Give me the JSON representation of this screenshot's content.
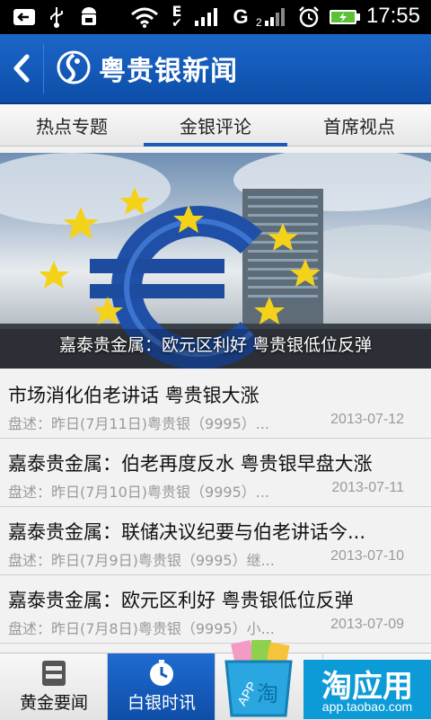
{
  "status_bar": {
    "time": "17:55",
    "icons": [
      "back-arrow-icon",
      "usb-icon",
      "android-icon",
      "wifi-icon",
      "edge-signal-icon",
      "signal-bars-icon",
      "g-network-icon",
      "signal-bars-2-icon",
      "alarm-icon",
      "battery-charging-icon"
    ],
    "signal_label_e": "E",
    "signal_label_g": "G"
  },
  "app_bar": {
    "title": "粤贵银新闻",
    "back_icon": "chevron-left-icon",
    "logo_icon": "swirl-logo-icon",
    "color": "#0d4ea8"
  },
  "tabs": [
    {
      "label": "热点专题",
      "active": false
    },
    {
      "label": "金银评论",
      "active": true
    },
    {
      "label": "首席视点",
      "active": false
    }
  ],
  "banner": {
    "caption": "嘉泰贵金属：欧元区利好 粤贵银低位反弹",
    "image_icon": "euro-sculpture-image"
  },
  "news": [
    {
      "title": "市场消化伯老讲话 粤贵银大涨",
      "summary": "盘述：昨日(7月11日)粤贵银（9995）...",
      "date": "2013-07-12"
    },
    {
      "title": "嘉泰贵金属：伯老再度反水 粤贵银早盘大涨",
      "summary": "盘述：昨日(7月10日)粤贵银（9995）...",
      "date": "2013-07-11"
    },
    {
      "title": "嘉泰贵金属：联储决议纪要与伯老讲话今...",
      "summary": "盘述：昨日(7月9日)粤贵银（9995）继...",
      "date": "2013-07-10"
    },
    {
      "title": "嘉泰贵金属：欧元区利好 粤贵银低位反弹",
      "summary": "盘述：昨日(7月8日)粤贵银（9995）小...",
      "date": "2013-07-09"
    }
  ],
  "bottom_nav": [
    {
      "label": "黄金要闻",
      "icon": "document-icon",
      "active": false
    },
    {
      "label": "白银时讯",
      "icon": "clock-icon",
      "active": true
    },
    {
      "label": "",
      "icon": "",
      "active": false
    },
    {
      "label": "",
      "icon": "",
      "active": false
    }
  ],
  "promo": {
    "brand": "淘应用",
    "url": "app.taobao.com",
    "bag_label": "APP",
    "bag_char": "淘"
  }
}
